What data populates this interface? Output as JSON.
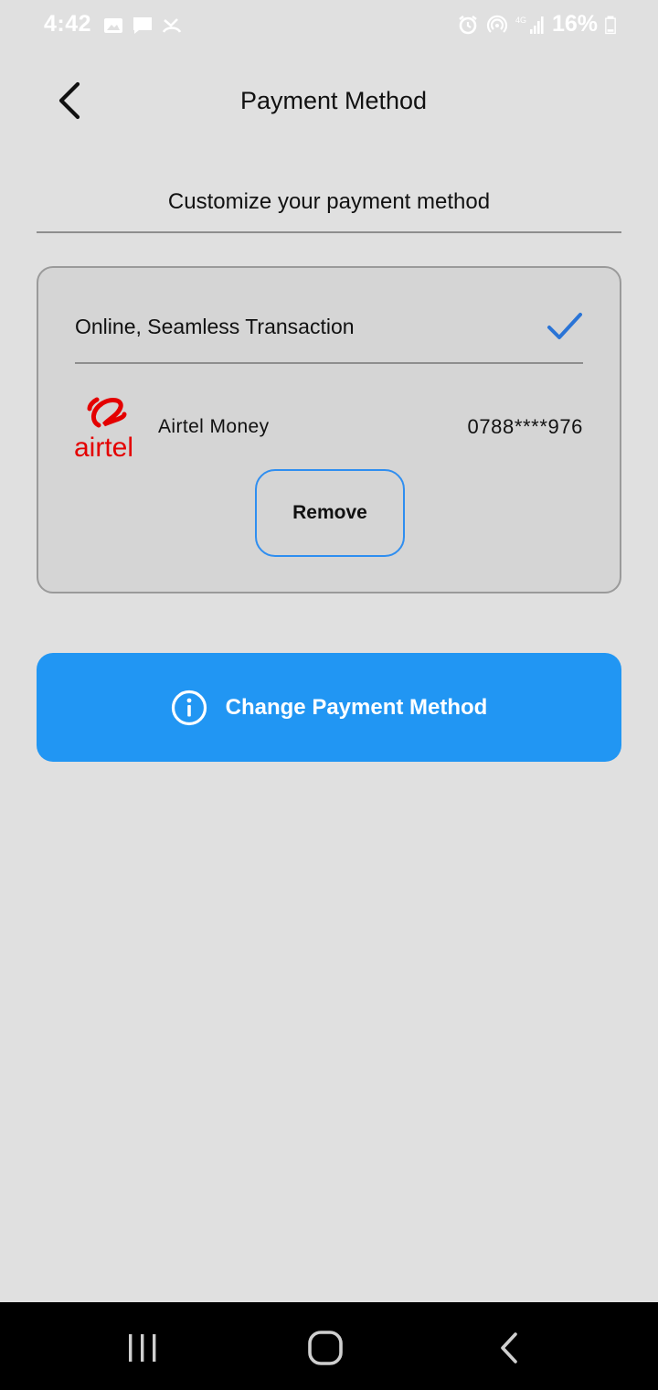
{
  "status_bar": {
    "time": "4:42",
    "battery": "16%",
    "icons_left": [
      "image-icon",
      "message-icon",
      "missed-call-icon"
    ],
    "icons_right": [
      "alarm-icon",
      "hotspot-icon",
      "4g-signal-icon",
      "battery-icon"
    ]
  },
  "header": {
    "title": "Payment Method",
    "back_icon": "chevron-left-icon"
  },
  "subtitle": "Customize your payment method",
  "card": {
    "header_label": "Online, Seamless Transaction",
    "selected_icon": "checkmark-icon",
    "method": {
      "logo_text": "airtel",
      "name": "Airtel Money",
      "number": "0788****976"
    },
    "remove_label": "Remove"
  },
  "change_button": {
    "label": "Change Payment Method",
    "icon": "info-icon"
  },
  "colors": {
    "background": "#e0e0e0",
    "accent": "#2196f3",
    "card_background": "#d5d5d5",
    "airtel_red": "#e40000"
  },
  "nav_bar": {
    "buttons": [
      "recents-icon",
      "home-icon",
      "back-icon"
    ]
  }
}
